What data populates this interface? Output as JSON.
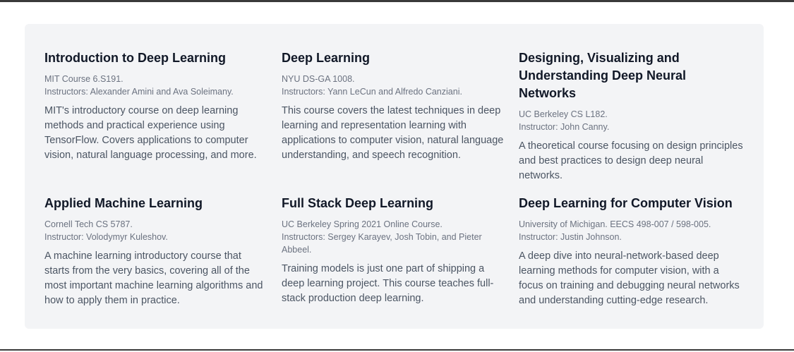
{
  "courses": [
    {
      "title": "Introduction to Deep Learning",
      "course": "MIT Course 6.S191.",
      "instructors": "Instructors: Alexander Amini and Ava Soleimany.",
      "description": "MIT's introductory course on deep learning methods and practical experience using TensorFlow. Covers applications to computer vision, natural language processing, and more."
    },
    {
      "title": "Deep Learning",
      "course": "NYU DS-GA 1008.",
      "instructors": "Instructors: Yann LeCun and Alfredo Canziani.",
      "description": "This course covers the latest techniques in deep learning and representation learning with applications to computer vision, natural language understanding, and speech recognition."
    },
    {
      "title": "Designing, Visualizing and Understanding Deep Neural Networks",
      "course": "UC Berkeley CS L182.",
      "instructors": "Instructor: John Canny.",
      "description": "A theoretical course focusing on design principles and best practices to design deep neural networks."
    },
    {
      "title": "Applied Machine Learning",
      "course": "Cornell Tech CS 5787.",
      "instructors": "Instructor: Volodymyr Kuleshov.",
      "description": "A machine learning introductory course that starts from the very basics, covering all of the most important machine learning algorithms and how to apply them in practice."
    },
    {
      "title": "Full Stack Deep Learning",
      "course": "UC Berkeley Spring 2021 Online Course.",
      "instructors": "Instructors: Sergey Karayev, Josh Tobin, and Pieter Abbeel.",
      "description": "Training models is just one part of shipping a deep learning project. This course teaches full-stack production deep learning."
    },
    {
      "title": "Deep Learning for Computer Vision",
      "course": "University of Michigan. EECS 498-007 / 598-005.",
      "instructors": "Instructor: Justin Johnson.",
      "description": "A deep dive into neural-network-based deep learning methods for computer vision, with a focus on training and debugging neural networks and understanding cutting-edge research."
    }
  ]
}
